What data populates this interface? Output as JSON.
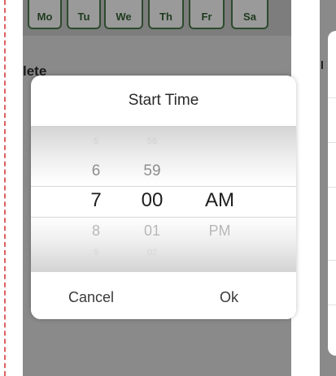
{
  "days": [
    "Mo",
    "Tu",
    "We",
    "Th",
    "Fr",
    "Sa"
  ],
  "list": {
    "delete_label": "lete",
    "right_label": "l"
  },
  "dialog": {
    "title": "Start Time",
    "picker": {
      "hours": [
        "5",
        "6",
        "7",
        "8",
        "9"
      ],
      "minutes": [
        "58",
        "59",
        "00",
        "01",
        "02"
      ],
      "ampm": [
        "AM",
        "PM"
      ],
      "selected": {
        "hour": "7",
        "minute": "00",
        "ampm": "AM"
      }
    },
    "cancel_label": "Cancel",
    "ok_label": "Ok"
  },
  "colors": {
    "accent_green": "#2f7a2f",
    "dialog_bg": "#ffffff",
    "overlay": "#8a8a8a"
  }
}
